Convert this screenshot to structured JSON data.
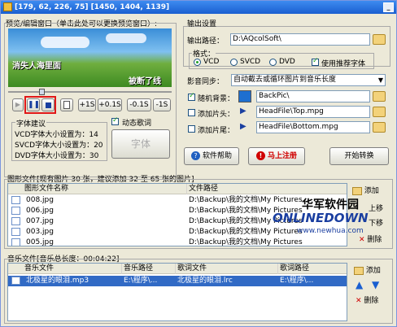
{
  "title": "[179, 62, 226, 75] [1450, 1404, 1139]",
  "preview": {
    "group_label": "预览/编辑窗口（单击此处可以更换预览窗口）:",
    "overlay_left": "消失人海里面",
    "overlay_right": "被断了线",
    "controls": {
      "plus1": "+1S",
      "plus01": "+0.1S",
      "minus01": "-0.1S",
      "minus1": "-1S"
    },
    "dynamic_lyrics": "动态歌词",
    "font_suggest": {
      "title": "字体建议",
      "vcd": "VCD字体大小设置为：14",
      "svcd": "SVCD字体大小设置为：20",
      "dvd": "DVD字体大小设置为：30"
    },
    "font_button": "字体"
  },
  "output": {
    "group_label": "输出设置",
    "path_label": "输出路径：",
    "path_value": "D:\\AQcolSoft\\",
    "format_label": "格式：",
    "formats": [
      "VCD",
      "SVCD",
      "DVD"
    ],
    "use_font": "使用推荐字体"
  },
  "sync": {
    "label": "影音同步：",
    "value": "自动截去或循环图片到音乐长度"
  },
  "bg": {
    "label": "随机背景：",
    "value": "BackPic\\"
  },
  "head": {
    "label": "添加片头：",
    "value": "HeadFile\\Top.mpg"
  },
  "tail": {
    "label": "添加片尾：",
    "value": "HeadFile\\Bottom.mpg"
  },
  "buttons": {
    "help": "软件帮助",
    "register": "马上注册",
    "start": "开始转换"
  },
  "images": {
    "group_label": "图形文件[现有图片 30 张，建议添加 32 至 65 张的图片]",
    "columns": [
      "图形文件名称",
      "文件路径"
    ],
    "rows": [
      {
        "name": "008.jpg",
        "path": "D:\\Backup\\我的文档\\My Pictures"
      },
      {
        "name": "006.jpg",
        "path": "D:\\Backup\\我的文档\\My Pictures"
      },
      {
        "name": "007.jpg",
        "path": "D:\\Backup\\我的文档\\My Pictures"
      },
      {
        "name": "003.jpg",
        "path": "D:\\Backup\\我的文档\\My Pictures"
      },
      {
        "name": "005.jpg",
        "path": "D:\\Backup\\我的文档\\My Pictures"
      }
    ],
    "side": {
      "add": "添加",
      "up": "上移",
      "down": "下移",
      "delete": "删除"
    }
  },
  "music": {
    "group_label": "音乐文件[音乐总长度：00:04:22]",
    "columns": [
      "音乐文件",
      "音乐路径",
      "歌词文件",
      "歌词路径"
    ],
    "rows": [
      {
        "file": "北极星的眼泪.mp3",
        "path": "E:\\程序\\...",
        "lyric": "北极星的眼泪.lrc",
        "lyric_path": "E:\\程序\\..."
      }
    ],
    "side": {
      "add": "添加",
      "delete": "删除"
    }
  },
  "watermark": {
    "cn": "华军软件园",
    "en": "ONLINEDOWN",
    "url": "www.newhua.com"
  }
}
